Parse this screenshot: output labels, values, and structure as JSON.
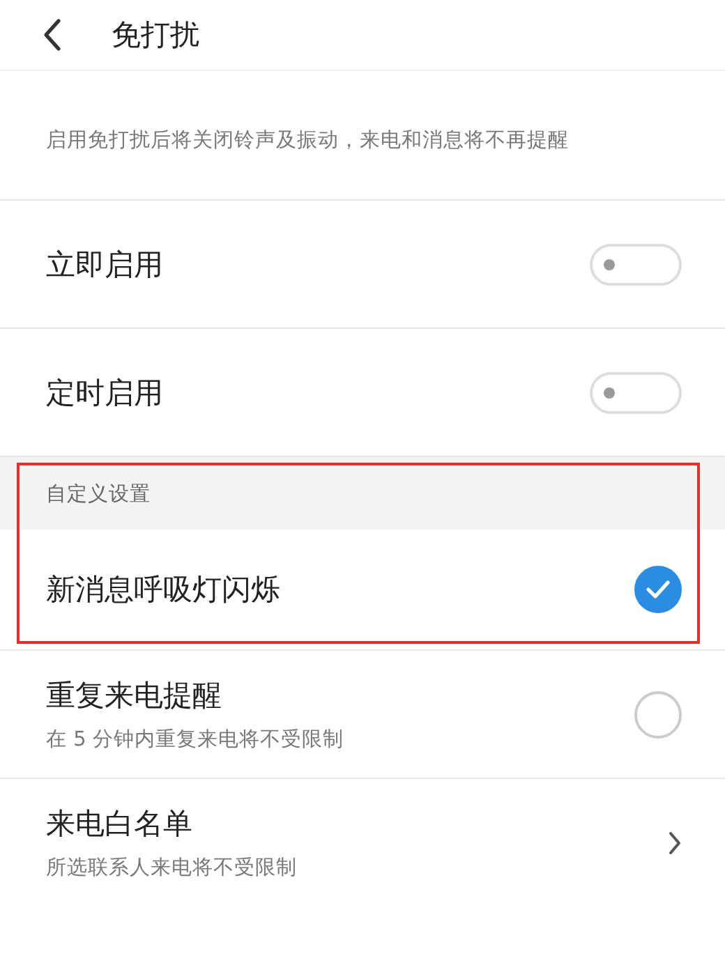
{
  "header": {
    "title": "免打扰"
  },
  "description": "启用免打扰后将关闭铃声及振动，来电和消息将不再提醒",
  "items": [
    {
      "kind": "toggle",
      "label": "立即启用",
      "on": false
    },
    {
      "kind": "toggle",
      "label": "定时启用",
      "on": false
    },
    {
      "kind": "section",
      "label": "自定义设置",
      "highlighted": true
    },
    {
      "kind": "check",
      "label": "新消息呼吸灯闪烁",
      "checked": true,
      "highlighted": true
    },
    {
      "kind": "check",
      "label": "重复来电提醒",
      "subtitle": "在 5 分钟内重复来电将不受限制",
      "checked": false
    },
    {
      "kind": "link",
      "label": "来电白名单",
      "subtitle": "所选联系人来电将不受限制"
    }
  ]
}
